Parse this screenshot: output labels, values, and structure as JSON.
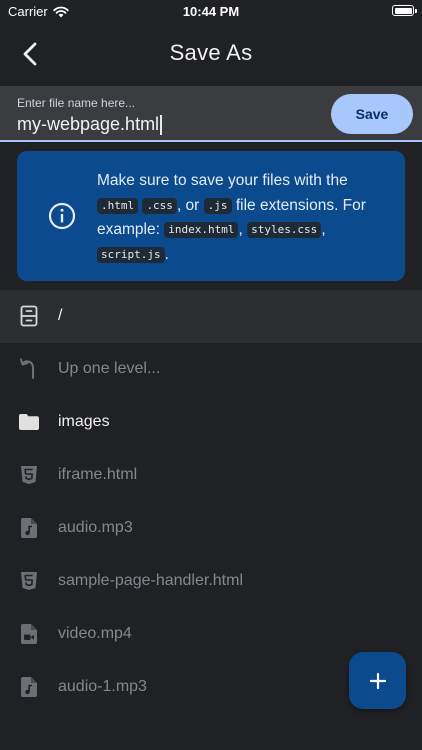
{
  "status_bar": {
    "carrier": "Carrier",
    "time": "10:44 PM"
  },
  "header": {
    "title": "Save As",
    "back_icon": "chevron-left-icon"
  },
  "filename": {
    "placeholder": "Enter file name here...",
    "value": "my-webpage.html",
    "save_label": "Save"
  },
  "info": {
    "icon": "info-icon",
    "text_1": "Make sure to save your files with the",
    "ext_html": ".html",
    "ext_css": ".css",
    "text_or": ", or",
    "ext_js": ".js",
    "text_2": "file extensions. For example:",
    "ex_index": "index.html",
    "ex_styles": "styles.css",
    "ex_script": "script.js",
    "comma": ",",
    "period": "."
  },
  "files": [
    {
      "name": "/",
      "icon": "storage-icon",
      "current": true,
      "dim": false
    },
    {
      "name": "Up one level...",
      "icon": "up-arrow-icon",
      "current": false,
      "dim": true
    },
    {
      "name": "images",
      "icon": "folder-icon",
      "current": false,
      "dim": false
    },
    {
      "name": "iframe.html",
      "icon": "html5-icon",
      "current": false,
      "dim": true
    },
    {
      "name": "audio.mp3",
      "icon": "audio-file-icon",
      "current": false,
      "dim": true
    },
    {
      "name": "sample-page-handler.html",
      "icon": "html5-icon",
      "current": false,
      "dim": true
    },
    {
      "name": "video.mp4",
      "icon": "video-file-icon",
      "current": false,
      "dim": true
    },
    {
      "name": "audio-1.mp3",
      "icon": "audio-file-icon",
      "current": false,
      "dim": true
    }
  ],
  "fab": {
    "icon": "plus-icon"
  },
  "colors": {
    "background": "#202124",
    "accent": "#a8c7fa",
    "info_card": "#0b4a8c",
    "dim_text": "#84878c"
  }
}
